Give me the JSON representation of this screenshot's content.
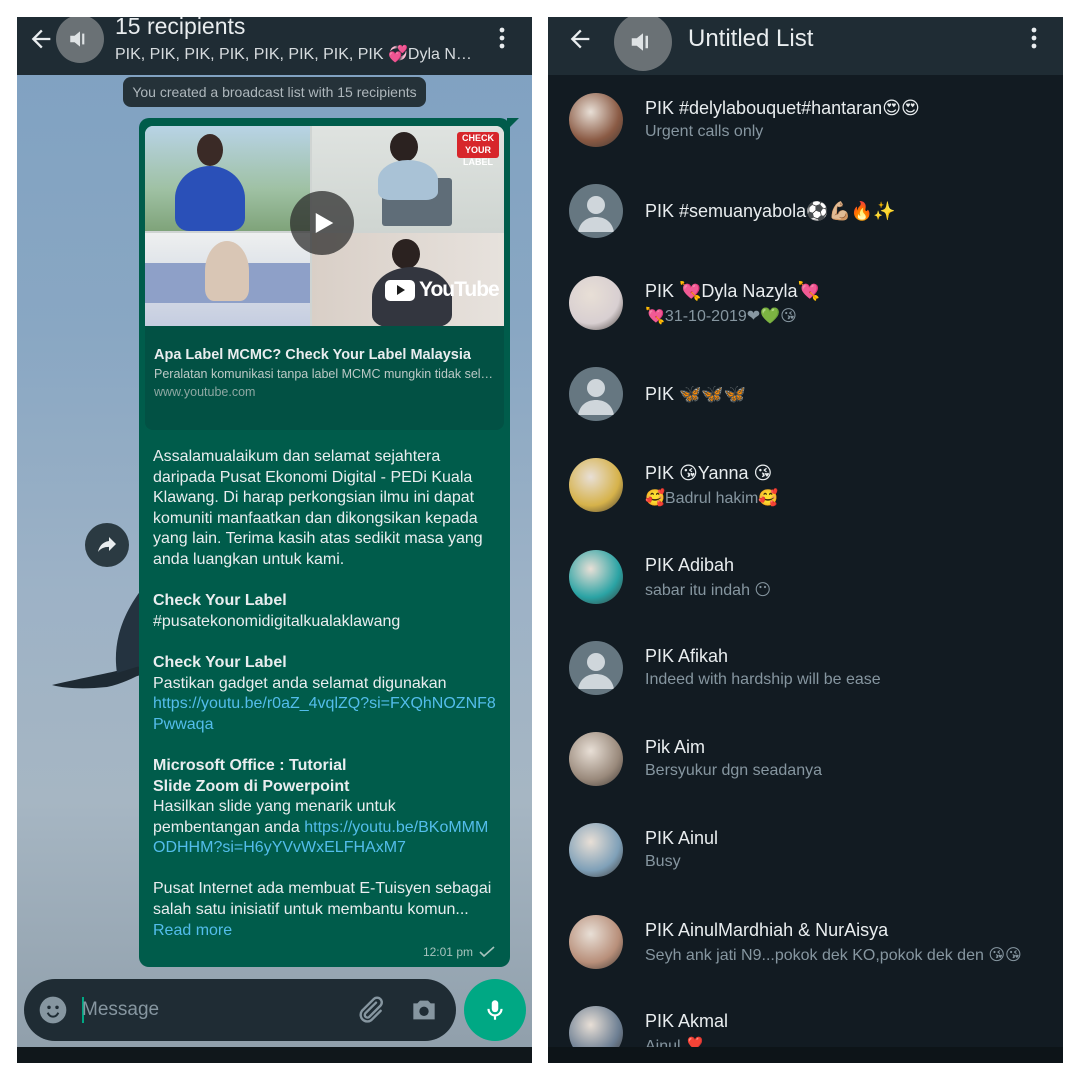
{
  "left": {
    "title": "15 recipients",
    "subtitle": "PIK, PIK, PIK, PIK, PIK, PIK, PIK, PIK 💞Dyla Nazyla💞",
    "system_message": "You created a broadcast list with 15 recipients",
    "preview": {
      "badge": "CHECK YOUR LABEL",
      "youtube": "YouTube",
      "title": "Apa Label MCMC? Check Your Label Malaysia",
      "description": "Peralatan komunikasi tanpa label MCMC mungkin tidak selamat digunakan",
      "domain": "www.youtube.com"
    },
    "message": {
      "p1": "Assalamualaikum dan selamat sejahtera daripada Pusat Ekonomi Digital - PEDi Kuala Klawang. Di harap perkongsian ilmu ini dapat komuniti manfaatkan dan dikongsikan kepada yang lain. Terima kasih atas sedikit masa yang anda luangkan untuk kami.",
      "h2": "Check Your Label",
      "p2": "#pusatekonomidigitalkualaklawang",
      "h3": "Check Your Label",
      "p3": "Pastikan gadget anda selamat digunakan",
      "link3": "https://youtu.be/r0aZ_4vqlZQ?si=FXQhNOZNF8Pwwaqa",
      "h4a": "Microsoft Office : Tutorial",
      "h4b": "Slide Zoom di Powerpoint",
      "p4": "Hasilkan slide yang menarik untuk pembentangan anda ",
      "link4": "https://youtu.be/BKoMMMODHHM?si=H6yYVvWxELFHAxM7",
      "p5": "Pusat Internet ada membuat E-Tuisyen sebagai salah satu inisiatif untuk membantu komun...",
      "read_more": "Read more"
    },
    "time": "12:01 pm",
    "composer_placeholder": "Message"
  },
  "right": {
    "title": "Untitled List",
    "contacts": [
      {
        "name": "PIK #delylabouquet#hantaran😍😍",
        "status": "Urgent calls only",
        "avatar": "photo",
        "color": "#8a5a44"
      },
      {
        "name": "PIK #semuanyabola⚽💪🏼🔥✨",
        "status": "",
        "avatar": "default",
        "color": "#667781"
      },
      {
        "name": "PIK 💘Dyla Nazyla💘",
        "status": "💘31-10-2019❤💚😘",
        "avatar": "photo",
        "color": "#d8cfd1"
      },
      {
        "name": "PIK 🦋🦋🦋",
        "status": "",
        "avatar": "default",
        "color": "#667781"
      },
      {
        "name": "PIK 😘Yanna 😘",
        "status": "🥰Badrul hakim🥰",
        "avatar": "photo",
        "color": "#d6b24a"
      },
      {
        "name": "PIK Adibah",
        "status": "sabar itu indah 😶",
        "avatar": "photo",
        "color": "#2aa3a4"
      },
      {
        "name": "PIK Afikah",
        "status": "Indeed with hardship will be ease",
        "avatar": "default",
        "color": "#667781"
      },
      {
        "name": "Pik Aim",
        "status": "Bersyukur dgn seadanya",
        "avatar": "photo",
        "color": "#9a8a7c"
      },
      {
        "name": "PIK Ainul",
        "status": "Busy",
        "avatar": "photo",
        "color": "#7fa0b8"
      },
      {
        "name": "PIK AinulMardhiah & NurAisya",
        "status": "Seyh ank jati N9...pokok dek KO,pokok dek den 😘😘",
        "avatar": "photo",
        "color": "#b88f7a"
      },
      {
        "name": "PIK Akmal",
        "status": "Ainul ❣️",
        "avatar": "photo",
        "color": "#6d7f93"
      }
    ]
  },
  "colors": {
    "appbar": "#1f2c34",
    "bubble": "#005c4b",
    "accent": "#00a884",
    "link": "#53bdeb",
    "list_bg": "#121b22"
  },
  "icons": [
    "back-arrow-icon",
    "broadcast-megaphone-icon",
    "more-vert-icon",
    "forward-icon",
    "play-icon",
    "emoji-icon",
    "attach-icon",
    "camera-icon",
    "mic-icon",
    "double-check-icon",
    "default-avatar-icon"
  ]
}
